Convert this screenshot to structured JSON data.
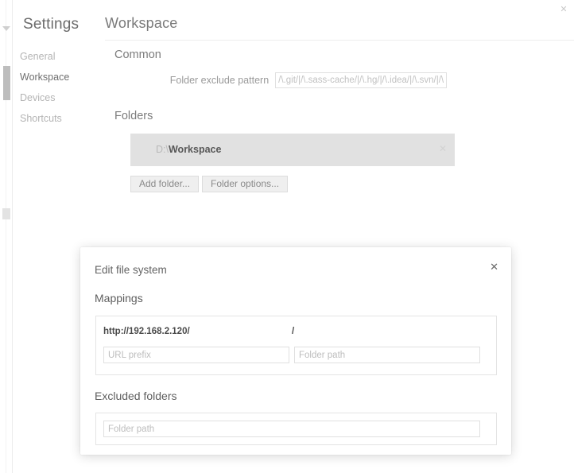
{
  "window": {
    "close_icon": "close-icon",
    "close_glyph": "✕"
  },
  "sidebar": {
    "title": "Settings",
    "items": [
      {
        "label": "General",
        "active": false
      },
      {
        "label": "Workspace",
        "active": true
      },
      {
        "label": "Devices",
        "active": false
      },
      {
        "label": "Shortcuts",
        "active": false
      }
    ]
  },
  "main": {
    "page_title": "Workspace",
    "common": {
      "heading": "Common",
      "exclude_pattern_label": "Folder exclude pattern",
      "exclude_pattern_value": "/\\.git/|/\\.sass-cache/|/\\.hg/|/\\.idea/|/\\.svn/|/\\.cache"
    },
    "folders": {
      "heading": "Folders",
      "entries": [
        {
          "drive": "D:\\",
          "name": "Workspace",
          "remove_glyph": "✕"
        }
      ],
      "add_folder_label": "Add folder...",
      "folder_options_label": "Folder options..."
    }
  },
  "modal": {
    "title": "Edit file system",
    "close_glyph": "✕",
    "mappings": {
      "heading": "Mappings",
      "rows": [
        {
          "url_prefix": "http://192.168.2.120/",
          "folder_path": "/"
        }
      ],
      "url_prefix_placeholder": "URL prefix",
      "folder_path_placeholder": "Folder path"
    },
    "excluded": {
      "heading": "Excluded folders",
      "folder_path_placeholder": "Folder path"
    }
  },
  "colors": {
    "accent_selected_row": "#e1e1e1",
    "text_muted": "#b4b4b4",
    "text_default": "#6e6e6e",
    "border": "#e0e0e0"
  }
}
